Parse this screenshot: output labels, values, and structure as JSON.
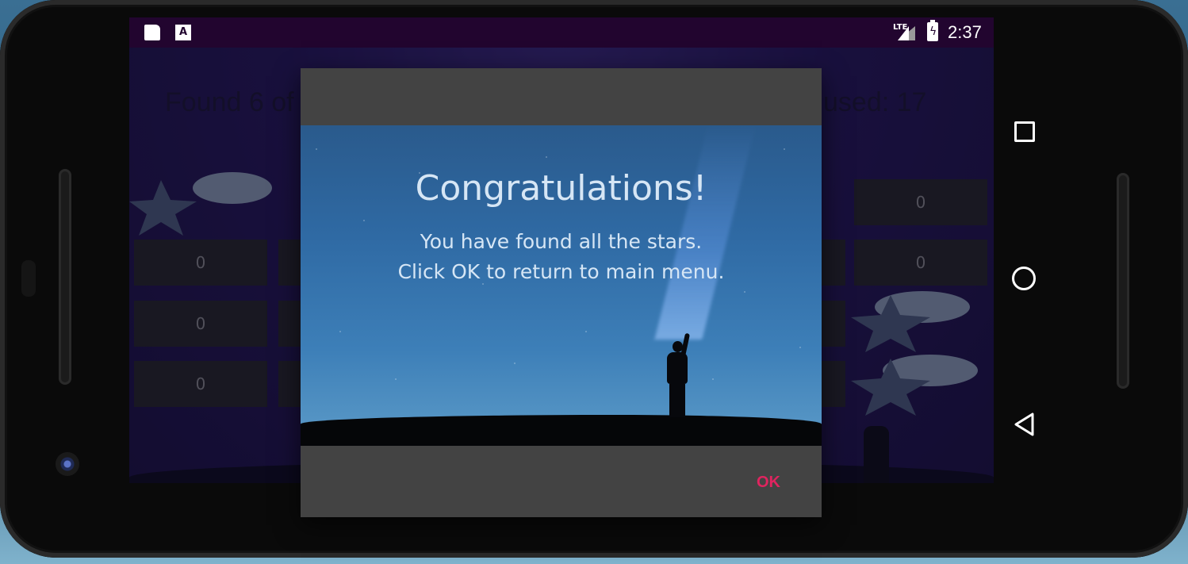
{
  "status_bar": {
    "time": "2:37",
    "network": "LTE",
    "icons": [
      "sd-card-icon",
      "a-notification-icon",
      "lte-signal-icon",
      "battery-charging-icon"
    ]
  },
  "background_game": {
    "found_text": "Found 6 of",
    "used_text": "used: 17",
    "cells": [
      "0",
      "0",
      "0",
      "0",
      "0"
    ]
  },
  "dialog": {
    "title": "Congratulations!",
    "line1": "You have found all the stars.",
    "line2": "Click OK to return to main menu.",
    "ok_label": "OK"
  },
  "navigation": {
    "buttons": [
      "recents-square-icon",
      "home-circle-icon",
      "back-triangle-icon"
    ]
  },
  "colors": {
    "accent": "#e0245f",
    "dialog_bg": "#434343",
    "status_bar": "#22052f"
  }
}
